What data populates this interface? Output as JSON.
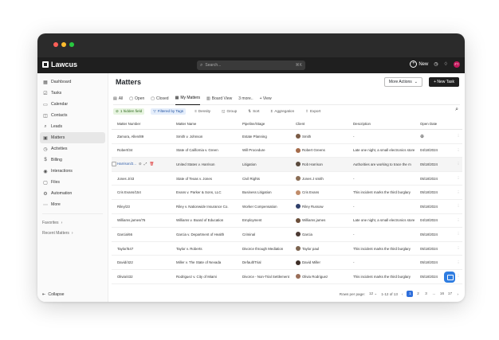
{
  "window": {
    "dots": [
      "#ff5f57",
      "#febc2e",
      "#28c840"
    ]
  },
  "app": {
    "brand": "Lawcus",
    "search_placeholder": "Search...",
    "search_shortcut": "⌘K",
    "new_label": "New",
    "user_initials": "FT"
  },
  "sidebar": {
    "items": [
      {
        "label": "Dashboard",
        "icon": "dashboard-icon",
        "glyph": "▦"
      },
      {
        "label": "Tasks",
        "icon": "tasks-icon",
        "glyph": "☑"
      },
      {
        "label": "Calendar",
        "icon": "calendar-icon",
        "glyph": "▭"
      },
      {
        "label": "Contacts",
        "icon": "contacts-icon",
        "glyph": "◫"
      },
      {
        "label": "Leads",
        "icon": "leads-icon",
        "glyph": "⌕"
      },
      {
        "label": "Matters",
        "icon": "briefcase-icon",
        "glyph": "▣"
      },
      {
        "label": "Activities",
        "icon": "activities-icon",
        "glyph": "◷"
      },
      {
        "label": "Billing",
        "icon": "billing-icon",
        "glyph": "$"
      },
      {
        "label": "Interactions",
        "icon": "interactions-icon",
        "glyph": "◉"
      },
      {
        "label": "Files",
        "icon": "files-icon",
        "glyph": "▢"
      },
      {
        "label": "Automation",
        "icon": "automation-icon",
        "glyph": "⚙"
      },
      {
        "label": "More",
        "icon": "more-icon",
        "glyph": "⋯"
      }
    ],
    "active_index": 5,
    "favorites": "Favorites",
    "recent": "Recent Matters",
    "collapse": "Collapse"
  },
  "main": {
    "title": "Matters",
    "more_actions": "More Actions",
    "new_task": "+ New Task",
    "tabs": [
      {
        "label": "All",
        "glyph": "▤"
      },
      {
        "label": "Open",
        "glyph": "▢"
      },
      {
        "label": "Closed",
        "glyph": "▢"
      },
      {
        "label": "My Matters",
        "glyph": "▦"
      },
      {
        "label": "Board View",
        "glyph": "▥"
      },
      {
        "label": "3 more..",
        "glyph": ""
      },
      {
        "label": "+ View",
        "glyph": ""
      }
    ],
    "active_tab": 3,
    "toolbar": {
      "hidden_field": "1 hidden field",
      "filtered": "Filtered by Tags",
      "density": "Density",
      "group": "Group",
      "sort": "Sort",
      "aggregation": "Aggregation",
      "export": "Export"
    }
  },
  "table": {
    "columns": [
      "Matter Number",
      "Matter Name",
      "Pipeline/Stage",
      "Client",
      "Description",
      "Open Date"
    ],
    "rows": [
      {
        "number": "Zamora, Allen/89",
        "name": "Smith v. Johnson",
        "stage": "Estate Planning",
        "client": "Smith",
        "client_color": "#7a5b45",
        "desc": "-",
        "date": ""
      },
      {
        "number": "Robert/34",
        "name": "State of California v. Green",
        "stage": "Will Procedure",
        "client": "Robert Greens",
        "client_color": "#a46b4a",
        "desc": "Late one night, a small electronics store",
        "date": "04/18/2024"
      },
      {
        "number": "Harrison/2...",
        "name": "United States v. Harrison",
        "stage": "Litigation",
        "client": "Rob Harrison",
        "client_color": "#5a4a3d",
        "desc": "Authorities are working to trace the m",
        "date": "05/18/2024"
      },
      {
        "number": "Jones J/43",
        "name": "State of Texas v. Jones",
        "stage": "Civil Rights",
        "client": "Jones J smith",
        "client_color": "#8a6d55",
        "desc": "-",
        "date": "05/18/2024"
      },
      {
        "number": "Cris Evans/154",
        "name": "Evans v. Parker & Sons, LLC",
        "stage": "Business Litigation",
        "client": "Cris Evans",
        "client_color": "#c08c6a",
        "desc": "This incident marks the third burglary",
        "date": "05/18/2024"
      },
      {
        "number": "Riley/23",
        "name": "Riley v. Nationwide Insurance Co.",
        "stage": "Worker Compensation",
        "client": "Riley Russow",
        "client_color": "#2f3f6a",
        "desc": "-",
        "date": "05/18/2024"
      },
      {
        "number": "Williams james/76",
        "name": "Williams v. Board of Education",
        "stage": "Employment",
        "client": "Williams james",
        "client_color": "#6b4e3a",
        "desc": "Late one night, a small electronics store",
        "date": "04/18/2024"
      },
      {
        "number": "Garcia/66",
        "name": "Garcia v. Department of Health",
        "stage": "Criminal",
        "client": "Garcia",
        "client_color": "#4b3a33",
        "desc": "-",
        "date": "05/18/2024"
      },
      {
        "number": "Taylor/547",
        "name": "Taylor v. Roberts",
        "stage": "Divorce through Mediation",
        "client": "Taylor paul",
        "client_color": "#7c6450",
        "desc": "This incident marks the third burglary",
        "date": "05/18/2024"
      },
      {
        "number": "David/422",
        "name": "Miller v. The State of Nevada",
        "stage": "Default/Trial",
        "client": "David Miller",
        "client_color": "#3d2e27",
        "desc": "-",
        "date": "05/18/2024"
      },
      {
        "number": "Olivia/432",
        "name": "Rodriguez v. City of Miami",
        "stage": "Divorce - Non-Trial Settlement",
        "client": "Olivia Rodriguez",
        "client_color": "#9a6e58",
        "desc": "This incident marks the third burglary",
        "date": "05/18/2024"
      }
    ],
    "highlight_row": 2
  },
  "pagination": {
    "rows_per_page_label": "Rows per page:",
    "rows_per_page": "12",
    "range": "1-12 of 13",
    "pages": [
      "1",
      "2",
      "3",
      "...",
      "16",
      "17"
    ],
    "active_page": "1"
  }
}
